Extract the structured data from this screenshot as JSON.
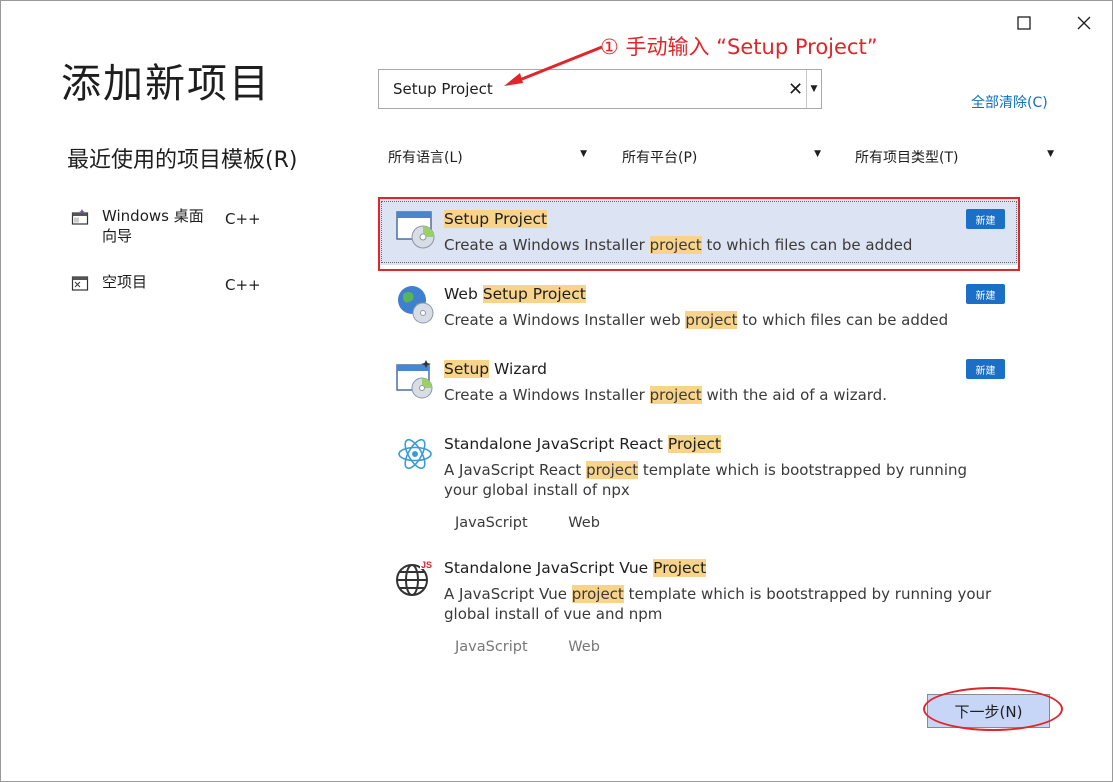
{
  "window": {
    "maximize_icon": "square-icon",
    "close_icon": "close-icon"
  },
  "page_title": "添加新项目",
  "recent": {
    "heading": "最近使用的项目模板(R)",
    "items": [
      {
        "name": "Windows 桌面向导",
        "lang": "C++",
        "icon": "wizard-icon"
      },
      {
        "name": "空项目",
        "lang": "C++",
        "icon": "empty-project-icon"
      }
    ]
  },
  "search": {
    "value": "Setup Project",
    "clear_glyph": "✕"
  },
  "clear_all": "全部清除(C)",
  "filters": {
    "language": "所有语言(L)",
    "platform": "所有平台(P)",
    "project_type": "所有项目类型(T)"
  },
  "templates": [
    {
      "name_parts": [
        {
          "t": "Setup Project",
          "hl": true
        }
      ],
      "desc_parts": [
        {
          "t": "Create a Windows Installer ",
          "hl": false
        },
        {
          "t": "project",
          "hl": true
        },
        {
          "t": " to which files can be added",
          "hl": false
        }
      ],
      "badge": "新建",
      "tags": [],
      "icon": "setup-project-icon"
    },
    {
      "name_parts": [
        {
          "t": "Web ",
          "hl": false
        },
        {
          "t": "Setup Project",
          "hl": true
        }
      ],
      "desc_parts": [
        {
          "t": "Create a Windows Installer web ",
          "hl": false
        },
        {
          "t": "project",
          "hl": true
        },
        {
          "t": " to which files can be added",
          "hl": false
        }
      ],
      "badge": "新建",
      "tags": [],
      "icon": "web-setup-icon"
    },
    {
      "name_parts": [
        {
          "t": "Setup",
          "hl": true
        },
        {
          "t": " Wizard",
          "hl": false
        }
      ],
      "desc_parts": [
        {
          "t": "Create a Windows Installer ",
          "hl": false
        },
        {
          "t": "project",
          "hl": true
        },
        {
          "t": " with the aid of a wizard.",
          "hl": false
        }
      ],
      "badge": "新建",
      "tags": [],
      "icon": "setup-wizard-icon"
    },
    {
      "name_parts": [
        {
          "t": "Standalone JavaScript React ",
          "hl": false
        },
        {
          "t": "Project",
          "hl": true
        }
      ],
      "desc_parts": [
        {
          "t": "A JavaScript React ",
          "hl": false
        },
        {
          "t": "project",
          "hl": true
        },
        {
          "t": " template which is bootstrapped by running your global install of npx",
          "hl": false
        }
      ],
      "badge": "",
      "tags": [
        "JavaScript",
        "Web"
      ],
      "icon": "react-icon"
    },
    {
      "name_parts": [
        {
          "t": "Standalone JavaScript Vue ",
          "hl": false
        },
        {
          "t": "Project",
          "hl": true
        }
      ],
      "desc_parts": [
        {
          "t": "A JavaScript Vue ",
          "hl": false
        },
        {
          "t": "project",
          "hl": true
        },
        {
          "t": " template which is bootstrapped by running your global install of vue and npm",
          "hl": false
        }
      ],
      "badge": "",
      "tags": [
        "JavaScript",
        "Web"
      ],
      "icon": "vue-globe-icon"
    }
  ],
  "next_button": "下一步(N)",
  "annotation": "① 手动输入 “Setup Project”",
  "colors": {
    "accent": "#1c6fc6",
    "highlight": "#f8d38a",
    "annotation_red": "#e0262a",
    "selected_bg": "#dce3f3"
  }
}
